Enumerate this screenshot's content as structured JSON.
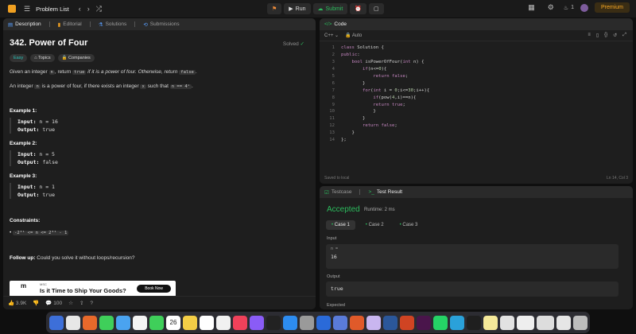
{
  "topbar": {
    "problem_list": "Problem List",
    "run": "Run",
    "submit": "Submit",
    "streak": "1",
    "premium": "Premium"
  },
  "left": {
    "tabs": [
      "Description",
      "Editorial",
      "Solutions",
      "Submissions"
    ],
    "title": "342. Power of Four",
    "solved": "Solved",
    "chips": [
      "Easy",
      "Topics",
      "Companies"
    ],
    "desc1_a": "Given an integer ",
    "desc1_b": "n",
    "desc1_c": ", return ",
    "desc1_d": "true",
    "desc1_e": " if it is a power of four. Otherwise, return ",
    "desc1_f": "false",
    "desc1_g": ".",
    "desc2_a": "An integer ",
    "desc2_b": "n",
    "desc2_c": " is a power of four, if there exists an integer ",
    "desc2_d": "x",
    "desc2_e": " such that ",
    "desc2_f": "n == 4ˣ",
    "desc2_g": ".",
    "examples": [
      {
        "head": "Example 1:",
        "input": "n = 16",
        "output": "true"
      },
      {
        "head": "Example 2:",
        "input": "n = 5",
        "output": "false"
      },
      {
        "head": "Example 3:",
        "input": "n = 1",
        "output": "true"
      }
    ],
    "input_label": "Input:",
    "output_label": "Output:",
    "constraints_head": "Constraints:",
    "constraint": "-2³¹ <= n <= 2³¹ - 1",
    "followup_label": "Follow up:",
    "followup_text": " Could you solve it without loops/recursion?",
    "ad": {
      "line1": "Is it Time to Ship Your Goods?",
      "brand": "MSC",
      "button": "Book Now"
    },
    "footer": {
      "likes": "3.9K",
      "comments": "100"
    }
  },
  "code": {
    "tab": "Code",
    "language": "C++",
    "mode": "Auto",
    "lines": [
      "class Solution {",
      "public:",
      "    bool isPowerOfFour(int n) {",
      "        if(n<=0){",
      "            return false;",
      "        }",
      "        for(int i = 0;i<=30;i++){",
      "            if(pow(4,i)==n){",
      "            return true;",
      "            }",
      "        }",
      "        return false;",
      "    }",
      "};"
    ],
    "saved": "Saved to local",
    "cursor": "Ln 14, Col 3"
  },
  "tests": {
    "tabs": [
      "Testcase",
      "Test Result"
    ],
    "status": "Accepted",
    "runtime": "Runtime: 2 ms",
    "cases": [
      "Case 1",
      "Case 2",
      "Case 3"
    ],
    "input_label": "Input",
    "var": "n =",
    "value": "16",
    "output_label": "Output",
    "output": "true",
    "expected_label": "Expected"
  },
  "dock": {
    "calendar_day": "26"
  }
}
